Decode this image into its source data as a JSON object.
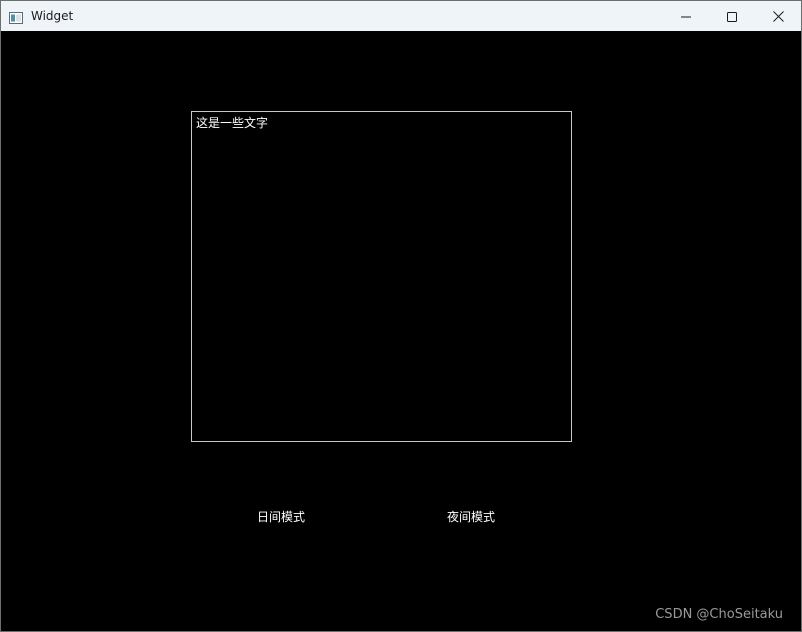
{
  "window": {
    "title": "Widget",
    "icons": {
      "app": "app-window-icon",
      "minimize": "minimize-icon",
      "maximize": "maximize-icon",
      "close": "close-icon"
    }
  },
  "editor": {
    "content": "这是一些文字"
  },
  "buttons": {
    "day_mode": "日间模式",
    "night_mode": "夜间模式"
  },
  "watermark": {
    "text": "CSDN @ChoSeitaku"
  },
  "colors": {
    "titlebar": "#eff4f9",
    "background": "#000000",
    "text": "#ffffff",
    "border": "#c8c8c8"
  }
}
